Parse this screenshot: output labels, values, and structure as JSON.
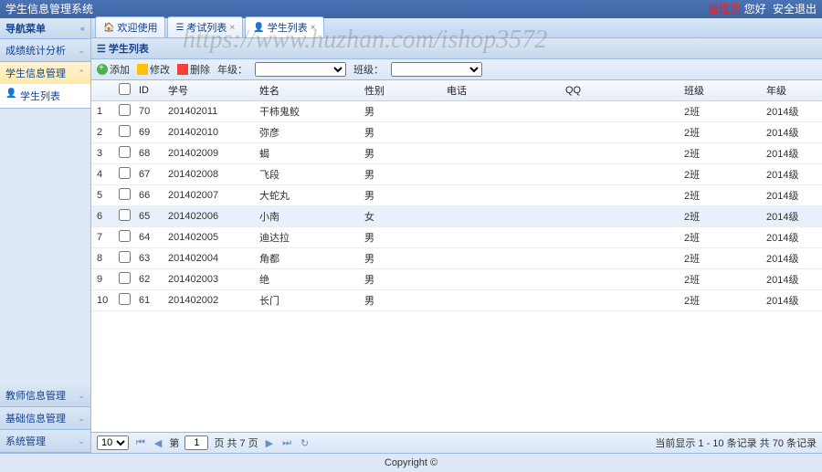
{
  "topbar": {
    "title": "学生信息管理系统",
    "admin": "管理员",
    "greeting": "您好",
    "logout": "安全退出"
  },
  "sidebar": {
    "header": "导航菜单",
    "items": [
      {
        "label": "成绩统计分析",
        "expanded": false
      },
      {
        "label": "学生信息管理",
        "expanded": true,
        "children": [
          {
            "label": "学生列表"
          }
        ]
      },
      {
        "label": "教师信息管理",
        "expanded": false
      },
      {
        "label": "基础信息管理",
        "expanded": false
      },
      {
        "label": "系统管理",
        "expanded": false
      }
    ]
  },
  "tabs": [
    {
      "label": "欢迎使用",
      "icon": "🏠",
      "closable": false
    },
    {
      "label": "考试列表",
      "icon": "☰",
      "closable": true
    },
    {
      "label": "学生列表",
      "icon": "👤",
      "closable": true,
      "active": true
    }
  ],
  "panel": {
    "title": "学生列表",
    "icon": "☰"
  },
  "toolbar": {
    "add": "添加",
    "edit": "修改",
    "delete": "删除",
    "grade_label": "年级：",
    "class_label": "班级："
  },
  "columns": {
    "id": "ID",
    "sno": "学号",
    "name": "姓名",
    "sex": "性别",
    "phone": "电话",
    "qq": "QQ",
    "clazz": "班级",
    "grade": "年级"
  },
  "rows": [
    {
      "idx": 1,
      "id": 70,
      "sno": "201402011",
      "name": "干柿鬼鲛",
      "sex": "男",
      "phone": "",
      "qq": "",
      "clazz": "2班",
      "grade": "2014级"
    },
    {
      "idx": 2,
      "id": 69,
      "sno": "201402010",
      "name": "弥彦",
      "sex": "男",
      "phone": "",
      "qq": "",
      "clazz": "2班",
      "grade": "2014级"
    },
    {
      "idx": 3,
      "id": 68,
      "sno": "201402009",
      "name": "蝎",
      "sex": "男",
      "phone": "",
      "qq": "",
      "clazz": "2班",
      "grade": "2014级"
    },
    {
      "idx": 4,
      "id": 67,
      "sno": "201402008",
      "name": "飞段",
      "sex": "男",
      "phone": "",
      "qq": "",
      "clazz": "2班",
      "grade": "2014级"
    },
    {
      "idx": 5,
      "id": 66,
      "sno": "201402007",
      "name": "大蛇丸",
      "sex": "男",
      "phone": "",
      "qq": "",
      "clazz": "2班",
      "grade": "2014级"
    },
    {
      "idx": 6,
      "id": 65,
      "sno": "201402006",
      "name": "小南",
      "sex": "女",
      "phone": "",
      "qq": "",
      "clazz": "2班",
      "grade": "2014级",
      "hl": true
    },
    {
      "idx": 7,
      "id": 64,
      "sno": "201402005",
      "name": "迪达拉",
      "sex": "男",
      "phone": "",
      "qq": "",
      "clazz": "2班",
      "grade": "2014级"
    },
    {
      "idx": 8,
      "id": 63,
      "sno": "201402004",
      "name": "角都",
      "sex": "男",
      "phone": "",
      "qq": "",
      "clazz": "2班",
      "grade": "2014级"
    },
    {
      "idx": 9,
      "id": 62,
      "sno": "201402003",
      "name": "绝",
      "sex": "男",
      "phone": "",
      "qq": "",
      "clazz": "2班",
      "grade": "2014级"
    },
    {
      "idx": 10,
      "id": 61,
      "sno": "201402002",
      "name": "长门",
      "sex": "男",
      "phone": "",
      "qq": "",
      "clazz": "2班",
      "grade": "2014级"
    }
  ],
  "pager": {
    "pagesize": "10",
    "page_label_prefix": "第",
    "page": "1",
    "page_label_suffix": "页 共 7 页",
    "info": "当前显示 1 - 10  条记录  共 70 条记录"
  },
  "footer": {
    "text": "Copyright ©"
  },
  "watermark": "https://www.huzhan.com/ishop3572"
}
